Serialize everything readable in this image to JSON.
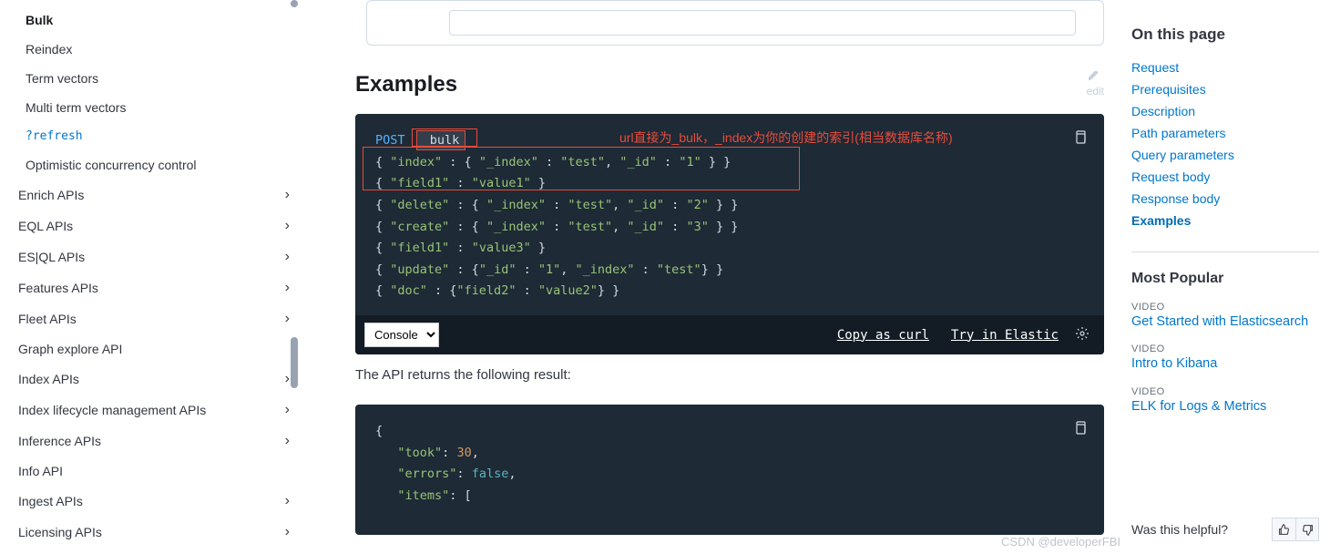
{
  "sidebar": {
    "items": [
      {
        "label": "Bulk",
        "cls": "sub active"
      },
      {
        "label": "Reindex",
        "cls": "sub"
      },
      {
        "label": "Term vectors",
        "cls": "sub"
      },
      {
        "label": "Multi term vectors",
        "cls": "sub"
      },
      {
        "label": "?refresh",
        "cls": "sub code"
      },
      {
        "label": "Optimistic concurrency control",
        "cls": "sub"
      },
      {
        "label": "Enrich APIs",
        "cls": "",
        "chev": true
      },
      {
        "label": "EQL APIs",
        "cls": "",
        "chev": true
      },
      {
        "label": "ES|QL APIs",
        "cls": "",
        "chev": true
      },
      {
        "label": "Features APIs",
        "cls": "",
        "chev": true
      },
      {
        "label": "Fleet APIs",
        "cls": "",
        "chev": true
      },
      {
        "label": "Graph explore API",
        "cls": ""
      },
      {
        "label": "Index APIs",
        "cls": "",
        "chev": true
      },
      {
        "label": "Index lifecycle management APIs",
        "cls": "",
        "chev": true
      },
      {
        "label": "Inference APIs",
        "cls": "",
        "chev": true
      },
      {
        "label": "Info API",
        "cls": ""
      },
      {
        "label": "Ingest APIs",
        "cls": "",
        "chev": true
      },
      {
        "label": "Licensing APIs",
        "cls": "",
        "chev": true
      }
    ]
  },
  "main": {
    "heading": "Examples",
    "edit_label": "edit",
    "code1": {
      "method": "POST",
      "endpoint": "_bulk",
      "annotation": "url直接为_bulk，_index为你的创建的索引(相当数据库名称)",
      "l1a": "{ ",
      "l1b": "\"index\"",
      "l1c": " : { ",
      "l1d": "\"_index\"",
      "l1e": " : ",
      "l1f": "\"test\"",
      "l1g": ", ",
      "l1h": "\"_id\"",
      "l1i": " : ",
      "l1j": "\"1\"",
      "l1k": " } }",
      "l2a": "{ ",
      "l2b": "\"field1\"",
      "l2c": " : ",
      "l2d": "\"value1\"",
      "l2e": " }",
      "l3a": "{ ",
      "l3b": "\"delete\"",
      "l3c": " : { ",
      "l3d": "\"_index\"",
      "l3e": " : ",
      "l3f": "\"test\"",
      "l3g": ", ",
      "l3h": "\"_id\"",
      "l3i": " : ",
      "l3j": "\"2\"",
      "l3k": " } }",
      "l4a": "{ ",
      "l4b": "\"create\"",
      "l4c": " : { ",
      "l4d": "\"_index\"",
      "l4e": " : ",
      "l4f": "\"test\"",
      "l4g": ", ",
      "l4h": "\"_id\"",
      "l4i": " : ",
      "l4j": "\"3\"",
      "l4k": " } }",
      "l5a": "{ ",
      "l5b": "\"field1\"",
      "l5c": " : ",
      "l5d": "\"value3\"",
      "l5e": " }",
      "l6a": "{ ",
      "l6b": "\"update\"",
      "l6c": " : {",
      "l6d": "\"_id\"",
      "l6e": " : ",
      "l6f": "\"1\"",
      "l6g": ", ",
      "l6h": "\"_index\"",
      "l6i": " : ",
      "l6j": "\"test\"",
      "l6k": "} }",
      "l7a": "{ ",
      "l7b": "\"doc\"",
      "l7c": " : {",
      "l7d": "\"field2\"",
      "l7e": " : ",
      "l7f": "\"value2\"",
      "l7g": "} }"
    },
    "toolbar": {
      "console": "Console",
      "copy": "Copy as curl",
      "try": "Try in Elastic"
    },
    "para": "The API returns the following result:",
    "code2": {
      "l1": "{",
      "l2a": "\"took\"",
      "l2b": ": ",
      "l2c": "30",
      "l2d": ",",
      "l3a": "\"errors\"",
      "l3b": ": ",
      "l3c": "false",
      "l3d": ",",
      "l4a": "\"items\"",
      "l4b": ": ["
    }
  },
  "right": {
    "toc_heading": "On this page",
    "toc": [
      "Request",
      "Prerequisites",
      "Description",
      "Path parameters",
      "Query parameters",
      "Request body",
      "Response body",
      "Examples"
    ],
    "pop_heading": "Most Popular",
    "pop_type": "VIDEO",
    "pop": [
      "Get Started with Elasticsearch",
      "Intro to Kibana",
      "ELK for Logs & Metrics"
    ],
    "feedback_q": "Was this helpful?"
  },
  "watermark": "CSDN @developerFBI"
}
